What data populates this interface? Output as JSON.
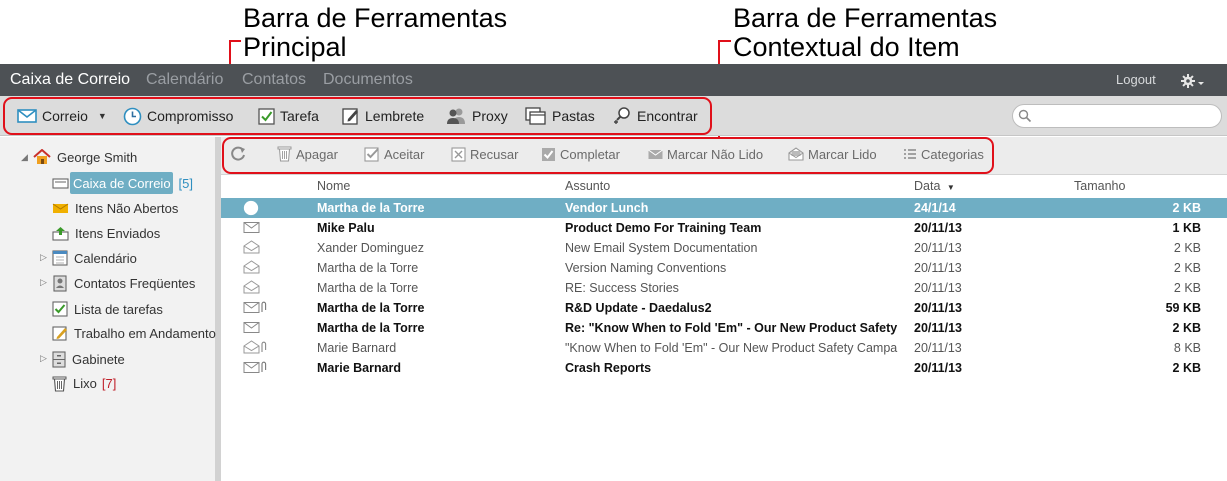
{
  "annotations": {
    "main_toolbar_line1": "Barra de Ferramentas",
    "main_toolbar_line2": "Principal",
    "context_toolbar_line1": "Barra de Ferramentas",
    "context_toolbar_line2": "Contextual do Item"
  },
  "nav": {
    "tabs": [
      "Caixa de Correio",
      "Calendário",
      "Contatos",
      "Documentos"
    ],
    "logout": "Logout"
  },
  "main_toolbar": {
    "mail": "Correio",
    "appointment": "Compromisso",
    "task": "Tarefa",
    "reminder": "Lembrete",
    "proxy": "Proxy",
    "folders": "Pastas",
    "find": "Encontrar",
    "search_placeholder": ""
  },
  "sidebar": {
    "user": "George Smith",
    "items": [
      {
        "label": "Caixa de Correio",
        "badge": "[5]"
      },
      {
        "label": "Itens Não Abertos",
        "badge": ""
      },
      {
        "label": "Itens Enviados",
        "badge": ""
      },
      {
        "label": "Calendário",
        "badge": ""
      },
      {
        "label": "Contatos Freqüentes",
        "badge": ""
      },
      {
        "label": "Lista de tarefas",
        "badge": ""
      },
      {
        "label": "Trabalho em Andamento",
        "badge": ""
      },
      {
        "label": "Gabinete",
        "badge": ""
      },
      {
        "label": "Lixo",
        "badge": "[7]"
      }
    ]
  },
  "context_toolbar": {
    "delete": "Apagar",
    "accept": "Aceitar",
    "decline": "Recusar",
    "complete": "Completar",
    "mark_unread": "Marcar Não Lido",
    "mark_read": "Marcar Lido",
    "categories": "Categorias"
  },
  "list": {
    "columns": {
      "from": "Nome",
      "subject": "Assunto",
      "date": "Data",
      "size": "Tamanho"
    },
    "rows": [
      {
        "from": "Martha de la Torre",
        "subject": "Vendor Lunch",
        "date": "24/1/14",
        "size": "2 KB",
        "icon": "clock-icon",
        "unread": true,
        "selected": true
      },
      {
        "from": "Mike Palu",
        "subject": "Product Demo For Training Team",
        "date": "20/11/13",
        "size": "1 KB",
        "icon": "envelope-closed-icon",
        "unread": true,
        "selected": false
      },
      {
        "from": "Xander Dominguez",
        "subject": "New Email System Documentation",
        "date": "20/11/13",
        "size": "2 KB",
        "icon": "envelope-open-icon",
        "unread": false,
        "selected": false
      },
      {
        "from": "Martha de la Torre",
        "subject": "Version Naming Conventions",
        "date": "20/11/13",
        "size": "2 KB",
        "icon": "envelope-open-icon",
        "unread": false,
        "selected": false
      },
      {
        "from": "Martha de la Torre",
        "subject": "RE: Success Stories",
        "date": "20/11/13",
        "size": "2 KB",
        "icon": "envelope-open-icon",
        "unread": false,
        "selected": false
      },
      {
        "from": "Martha de la Torre",
        "subject": "R&D Update - Daedalus2",
        "date": "20/11/13",
        "size": "59 KB",
        "icon": "envelope-attachment-icon",
        "unread": true,
        "selected": false
      },
      {
        "from": "Martha de la Torre",
        "subject": "Re: \"Know When to Fold 'Em\" - Our New Product Safety",
        "date": "20/11/13",
        "size": "2 KB",
        "icon": "envelope-closed-icon",
        "unread": true,
        "selected": false
      },
      {
        "from": "Marie Barnard",
        "subject": "\"Know When to Fold 'Em\" - Our New Product Safety Campa",
        "date": "20/11/13",
        "size": "8 KB",
        "icon": "envelope-open-attachment-icon",
        "unread": false,
        "selected": false
      },
      {
        "from": "Marie Barnard",
        "subject": "Crash Reports",
        "date": "20/11/13",
        "size": "2 KB",
        "icon": "envelope-attachment-icon",
        "unread": true,
        "selected": false
      }
    ]
  },
  "colors": {
    "nav_bg": "#4d5155",
    "toolbar_bg": "#dcdcdc",
    "selection": "#6faec4",
    "annotation_red": "#e0101a",
    "badge_blue": "#2f8fc0",
    "badge_red": "#c0202a"
  }
}
